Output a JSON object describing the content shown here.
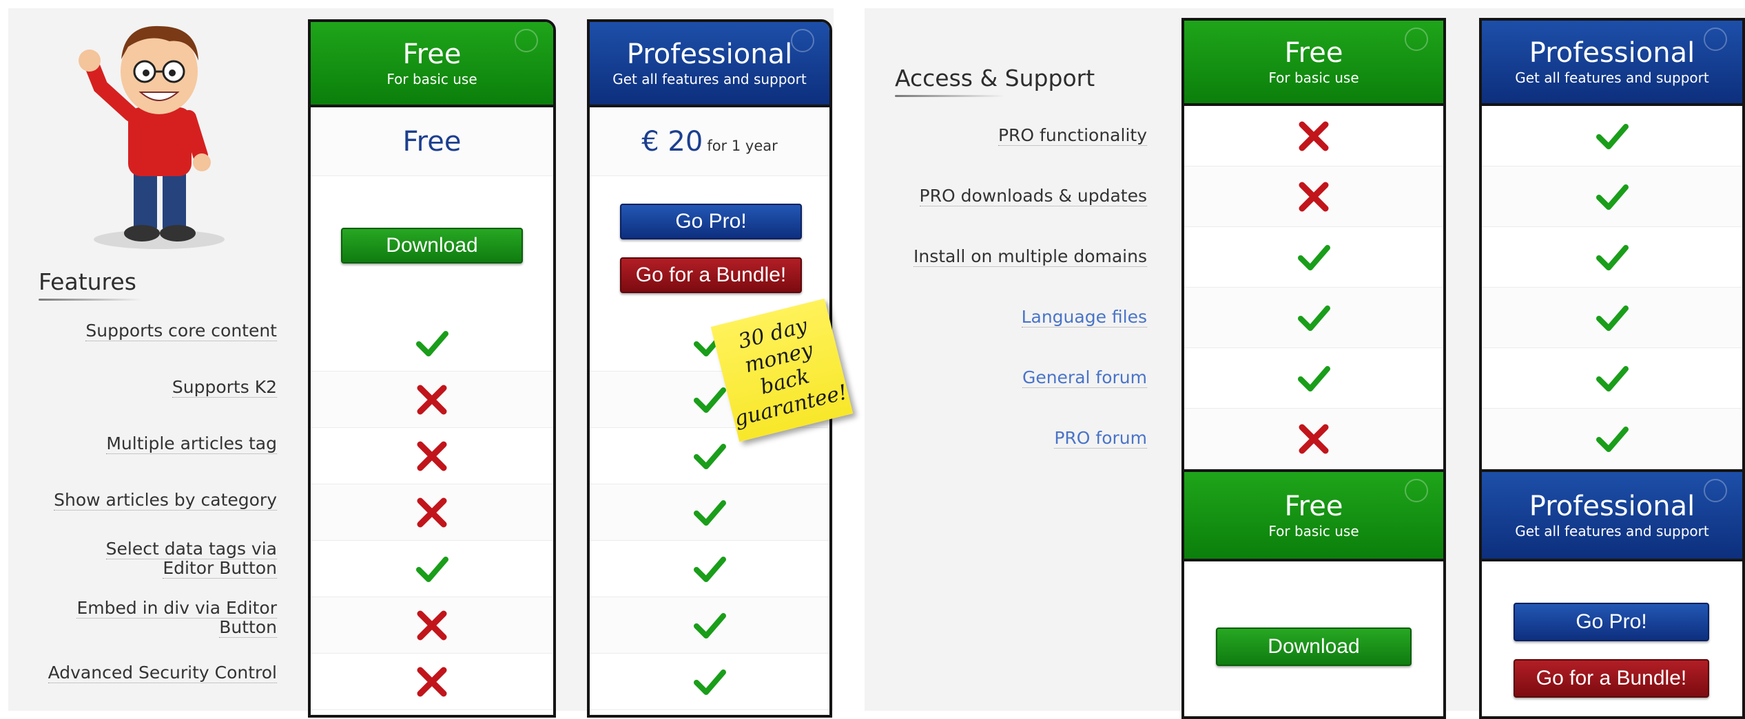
{
  "plans": {
    "free": {
      "title": "Free",
      "subtitle": "For basic use",
      "price": "Free",
      "download_label": "Download",
      "color": "#0b7f0b"
    },
    "pro": {
      "title": "Professional",
      "subtitle": "Get all features and support",
      "price": "€ 20",
      "price_period": "for 1 year",
      "go_pro_label": "Go Pro!",
      "bundle_label": "Go for a Bundle!",
      "color": "#0d2f7d"
    }
  },
  "features": {
    "title": "Features",
    "rows": [
      {
        "label": "Supports core content",
        "free": "check",
        "pro": "check"
      },
      {
        "label": "Supports K2",
        "free": "cross",
        "pro": "check"
      },
      {
        "label": "Multiple articles tag",
        "free": "cross",
        "pro": "check"
      },
      {
        "label": "Show articles by category",
        "free": "cross",
        "pro": "check"
      },
      {
        "label": "Select data tags via Editor Button",
        "free": "check",
        "pro": "check"
      },
      {
        "label": "Embed in div via Editor Button",
        "free": "cross",
        "pro": "check"
      },
      {
        "label": "Advanced Security Control",
        "free": "cross",
        "pro": "check"
      }
    ]
  },
  "access": {
    "title": "Access & Support",
    "rows": [
      {
        "label": "PRO functionality",
        "free": "cross",
        "pro": "check",
        "link": false
      },
      {
        "label": "PRO downloads & updates",
        "free": "cross",
        "pro": "check",
        "link": false
      },
      {
        "label": "Install on multiple domains",
        "free": "check",
        "pro": "check",
        "link": false
      },
      {
        "label": "Language files",
        "free": "check",
        "pro": "check",
        "link": true
      },
      {
        "label": "General forum",
        "free": "check",
        "pro": "check",
        "link": true
      },
      {
        "label": "PRO forum",
        "free": "cross",
        "pro": "check",
        "link": true
      }
    ]
  },
  "sticky_note": {
    "text": "30 day money back guarantee!"
  },
  "icons": {
    "check": "check-icon",
    "cross": "cross-icon",
    "mascot": "mascot-illustration"
  },
  "colors": {
    "check": "#1a9e1a",
    "cross": "#c1151b",
    "link": "#4a74c9"
  }
}
